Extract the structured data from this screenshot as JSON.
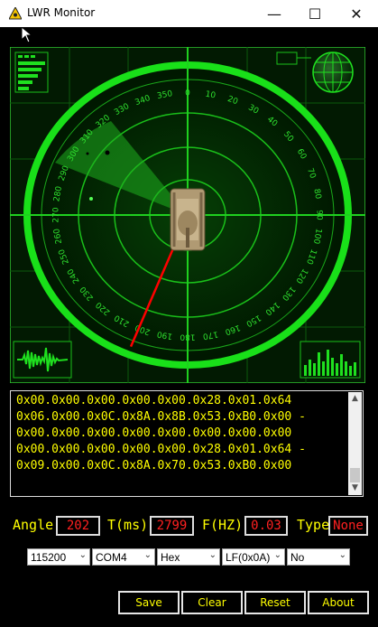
{
  "window": {
    "title": "LWR Monitor",
    "controls": {
      "minimize": "—",
      "maximize": "☐",
      "close": "✕"
    }
  },
  "radar": {
    "bearing_labels": [
      "0",
      "10",
      "20",
      "30",
      "40",
      "50",
      "60",
      "70",
      "80",
      "90",
      "100",
      "110",
      "120",
      "130",
      "140",
      "150",
      "160",
      "170",
      "180",
      "190",
      "200",
      "210",
      "220",
      "230",
      "240",
      "250",
      "260",
      "270",
      "280",
      "290",
      "300",
      "310",
      "320",
      "330",
      "340",
      "350"
    ],
    "pointer_angle": 202,
    "colors": {
      "grid": "#00ff00",
      "background": "#001a00",
      "pointer": "#ff0000"
    }
  },
  "console": {
    "lines": [
      "0x00.0x00.0x00.0x00.0x00.0x28.0x01.0x64",
      "0x06.0x00.0x0C.0x8A.0x8B.0x53.0xB0.0x00 -",
      "0x00.0x00.0x00.0x00.0x00.0x00.0x00.0x00",
      "0x00.0x00.0x00.0x00.0x00.0x28.0x01.0x64 -",
      "0x09.0x00.0x0C.0x8A.0x70.0x53.0xB0.0x00"
    ]
  },
  "params": {
    "angle_label": "Angle",
    "angle_value": "202",
    "time_label": "T(ms)",
    "time_value": "2799",
    "freq_label": "F(HZ)",
    "freq_value": "0.03",
    "type_label": "Type",
    "type_value": "None"
  },
  "settings": {
    "baud": "115200",
    "port": "COM4",
    "format": "Hex",
    "line_ending": "LF(0x0A)",
    "option": "No"
  },
  "buttons": {
    "save": "Save",
    "clear": "Clear",
    "reset": "Reset",
    "about": "About"
  }
}
